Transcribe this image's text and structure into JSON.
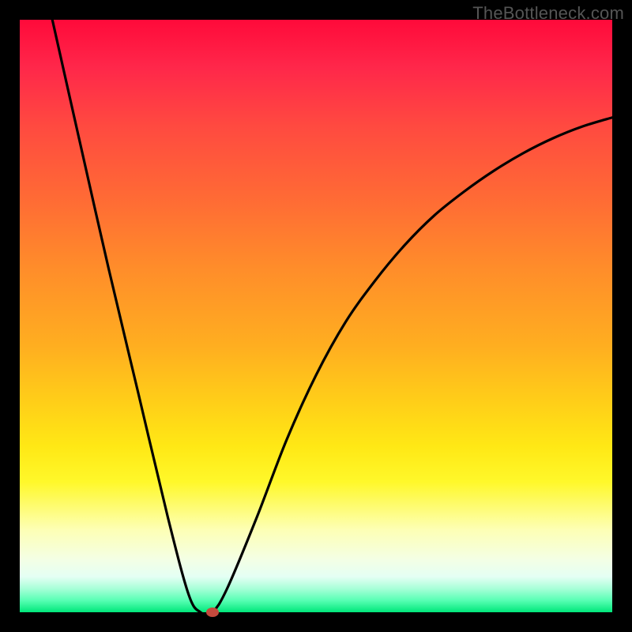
{
  "watermark": "TheBottleneck.com",
  "chart_data": {
    "type": "line",
    "title": "",
    "xlabel": "",
    "ylabel": "",
    "x_range": [
      0,
      1
    ],
    "y_range": [
      0,
      100
    ],
    "gradient_stops": [
      {
        "pos": 0,
        "color": "#ff0a3a"
      },
      {
        "pos": 8,
        "color": "#ff274a"
      },
      {
        "pos": 18,
        "color": "#ff4a40"
      },
      {
        "pos": 30,
        "color": "#ff6a35"
      },
      {
        "pos": 42,
        "color": "#ff8d2a"
      },
      {
        "pos": 55,
        "color": "#ffae20"
      },
      {
        "pos": 65,
        "color": "#ffd018"
      },
      {
        "pos": 72,
        "color": "#ffe815"
      },
      {
        "pos": 78,
        "color": "#fff82a"
      },
      {
        "pos": 86,
        "color": "#fdffb4"
      },
      {
        "pos": 91,
        "color": "#f4ffe4"
      },
      {
        "pos": 94,
        "color": "#e4fff4"
      },
      {
        "pos": 96,
        "color": "#a8ffd8"
      },
      {
        "pos": 98,
        "color": "#58ffb4"
      },
      {
        "pos": 100,
        "color": "#00e77a"
      }
    ],
    "series": [
      {
        "name": "bottleneck-curve",
        "x": [
          0.055,
          0.1,
          0.15,
          0.2,
          0.25,
          0.285,
          0.305,
          0.325,
          0.35,
          0.4,
          0.45,
          0.5,
          0.55,
          0.6,
          0.65,
          0.7,
          0.75,
          0.8,
          0.85,
          0.9,
          0.95,
          1.0
        ],
        "y_percent": [
          100,
          80,
          58,
          37,
          16,
          3,
          0,
          0,
          4,
          16,
          29,
          40,
          49,
          56,
          62,
          67,
          71,
          74.5,
          77.5,
          80,
          82,
          83.5
        ]
      }
    ],
    "marker": {
      "x": 0.325,
      "y_percent": 0,
      "color": "#c44a3d"
    },
    "frame_border_px": 25
  }
}
